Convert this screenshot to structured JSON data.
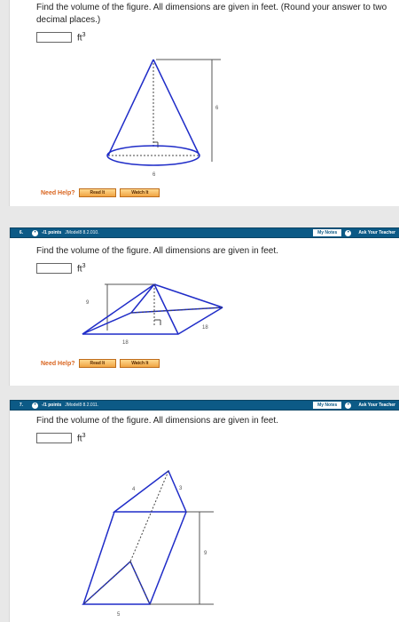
{
  "q1": {
    "prompt": "Find the volume of the figure. All dimensions are given in feet. (Round your answer to two decimal places.)",
    "unit": "ft",
    "unit_exp": "3",
    "figure": {
      "height": "6",
      "diameter": "6"
    },
    "help": {
      "label": "Need Help?",
      "read": "Read It",
      "watch": "Watch It"
    }
  },
  "q2": {
    "number": "6.",
    "points": "-/1 points",
    "source": "JModel8 8.2.010.",
    "my_notes": "My Notes",
    "ask": "Ask Your Teacher",
    "prompt": "Find the volume of the figure. All dimensions are given in feet.",
    "unit": "ft",
    "unit_exp": "3",
    "figure": {
      "height": "9",
      "base": "18",
      "side": "18"
    },
    "help": {
      "label": "Need Help?",
      "read": "Read It",
      "watch": "Watch It"
    }
  },
  "q3": {
    "number": "7.",
    "points": "-/1 points",
    "source": "JModel8 8.2.011.",
    "my_notes": "My Notes",
    "ask": "Ask Your Teacher",
    "prompt": "Find the volume of the figure. All dimensions are given in feet.",
    "unit": "ft",
    "unit_exp": "3",
    "figure": {
      "top_left": "4",
      "top_right": "3",
      "height": "9",
      "base": "5"
    }
  }
}
